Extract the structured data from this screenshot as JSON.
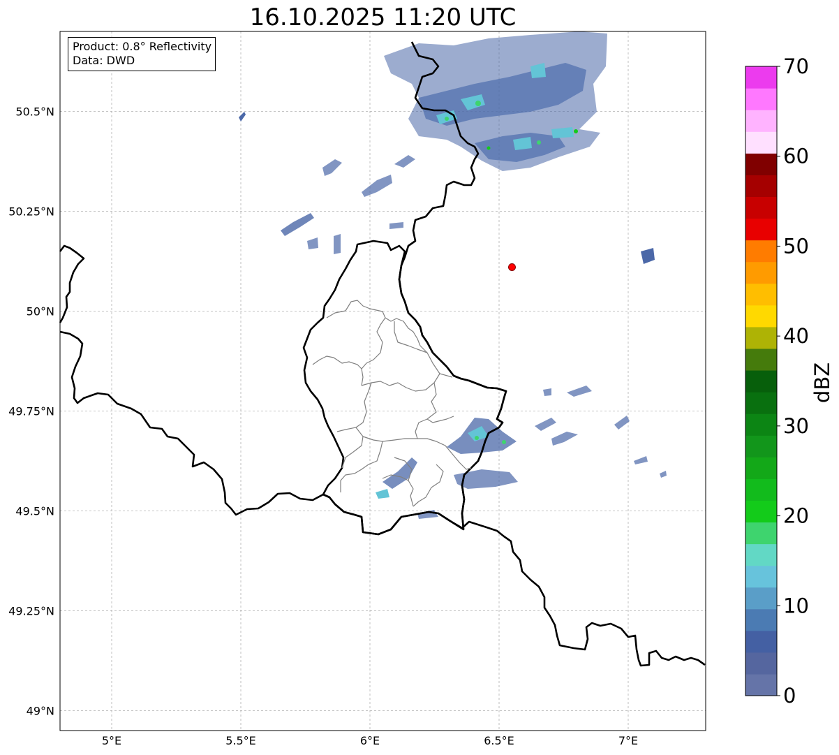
{
  "title": "16.10.2025 11:20 UTC",
  "info_box": {
    "product": "Product: 0.8° Reflectivity",
    "data": "Data: DWD"
  },
  "map": {
    "lon_range": [
      4.8,
      7.3
    ],
    "lat_range": [
      48.95,
      50.7
    ],
    "grid": true,
    "x_ticks": [
      "5°E",
      "5.5°E",
      "6°E",
      "6.5°E",
      "7°E"
    ],
    "y_ticks": [
      "49°N",
      "49.25°N",
      "49.5°N",
      "49.75°N",
      "50°N",
      "50.25°N",
      "50.5°N"
    ],
    "marker": {
      "lon": 6.55,
      "lat": 50.11,
      "color": "#ff0000"
    }
  },
  "colorbar": {
    "label": "dBZ",
    "min": 0,
    "max": 70,
    "tick_labels": [
      "0",
      "10",
      "20",
      "30",
      "40",
      "50",
      "60",
      "70"
    ],
    "colors": [
      "#6574a8",
      "#55669f",
      "#4460a3",
      "#4b7bb3",
      "#5a9ec8",
      "#67c3dc",
      "#62d8c5",
      "#3ed46e",
      "#13cb1a",
      "#12bb1c",
      "#13a818",
      "#12961b",
      "#0c8514",
      "#09700f",
      "#075f0b",
      "#457b0c",
      "#aeb305",
      "#ffd900",
      "#ffbe00",
      "#ff9b00",
      "#ff7c00",
      "#e80000",
      "#c80000",
      "#a50000",
      "#800000",
      "#ffe0ff",
      "#ffb3ff",
      "#ff78ff",
      "#ec3bee"
    ]
  }
}
